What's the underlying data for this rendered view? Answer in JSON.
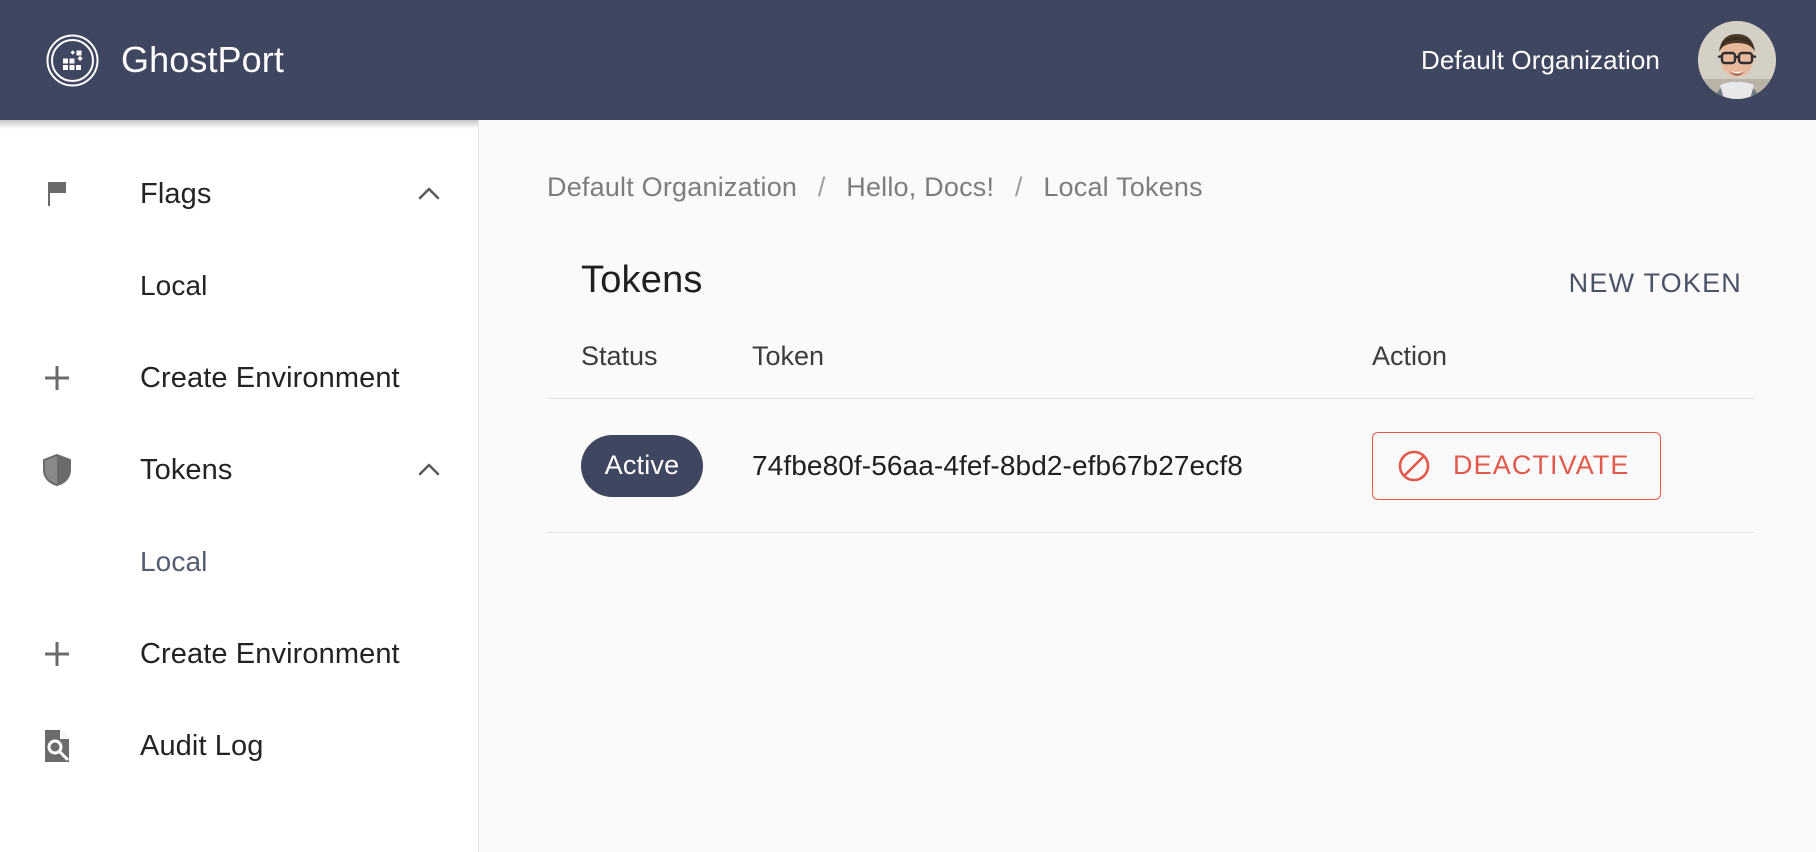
{
  "topbar": {
    "brand_name": "GhostPort",
    "logo_icon": "ghostport-circle-dots-logo",
    "organization": "Default Organization",
    "avatar_icon": "user-avatar-photo"
  },
  "sidebar": {
    "items": [
      {
        "label": "Flags",
        "icon": "flag-icon",
        "caret": "chevron-up-icon",
        "type": "group",
        "active": false
      },
      {
        "label": "Local",
        "icon": "",
        "caret": "",
        "type": "child",
        "active": false
      },
      {
        "label": "Create Environment",
        "icon": "plus-icon",
        "caret": "",
        "type": "action",
        "active": false
      },
      {
        "label": "Tokens",
        "icon": "shield-icon",
        "caret": "chevron-up-icon",
        "type": "group",
        "active": false
      },
      {
        "label": "Local",
        "icon": "",
        "caret": "",
        "type": "child",
        "active": true
      },
      {
        "label": "Create Environment",
        "icon": "plus-icon",
        "caret": "",
        "type": "action",
        "active": false
      },
      {
        "label": "Audit Log",
        "icon": "document-search-icon",
        "caret": "",
        "type": "link",
        "active": false
      }
    ]
  },
  "breadcrumb": {
    "items": [
      "Default Organization",
      "Hello, Docs!",
      "Local Tokens"
    ],
    "separator": "/"
  },
  "card": {
    "title": "Tokens",
    "new_token_label": "NEW TOKEN",
    "columns": [
      "Status",
      "Token",
      "Action"
    ],
    "rows": [
      {
        "status": "Active",
        "token": "74fbe80f-56aa-4fef-8bd2-efb67b27ecf8",
        "action_label": "DEACTIVATE",
        "action_icon": "ban-circle-slash-icon"
      }
    ]
  },
  "colors": {
    "topbar_bg": "#3f4660",
    "badge_bg": "#3f4660",
    "accent_link": "#4a5268",
    "danger": "#e2584a",
    "main_bg": "#fafafa",
    "sidebar_active_text": "#545c74"
  }
}
